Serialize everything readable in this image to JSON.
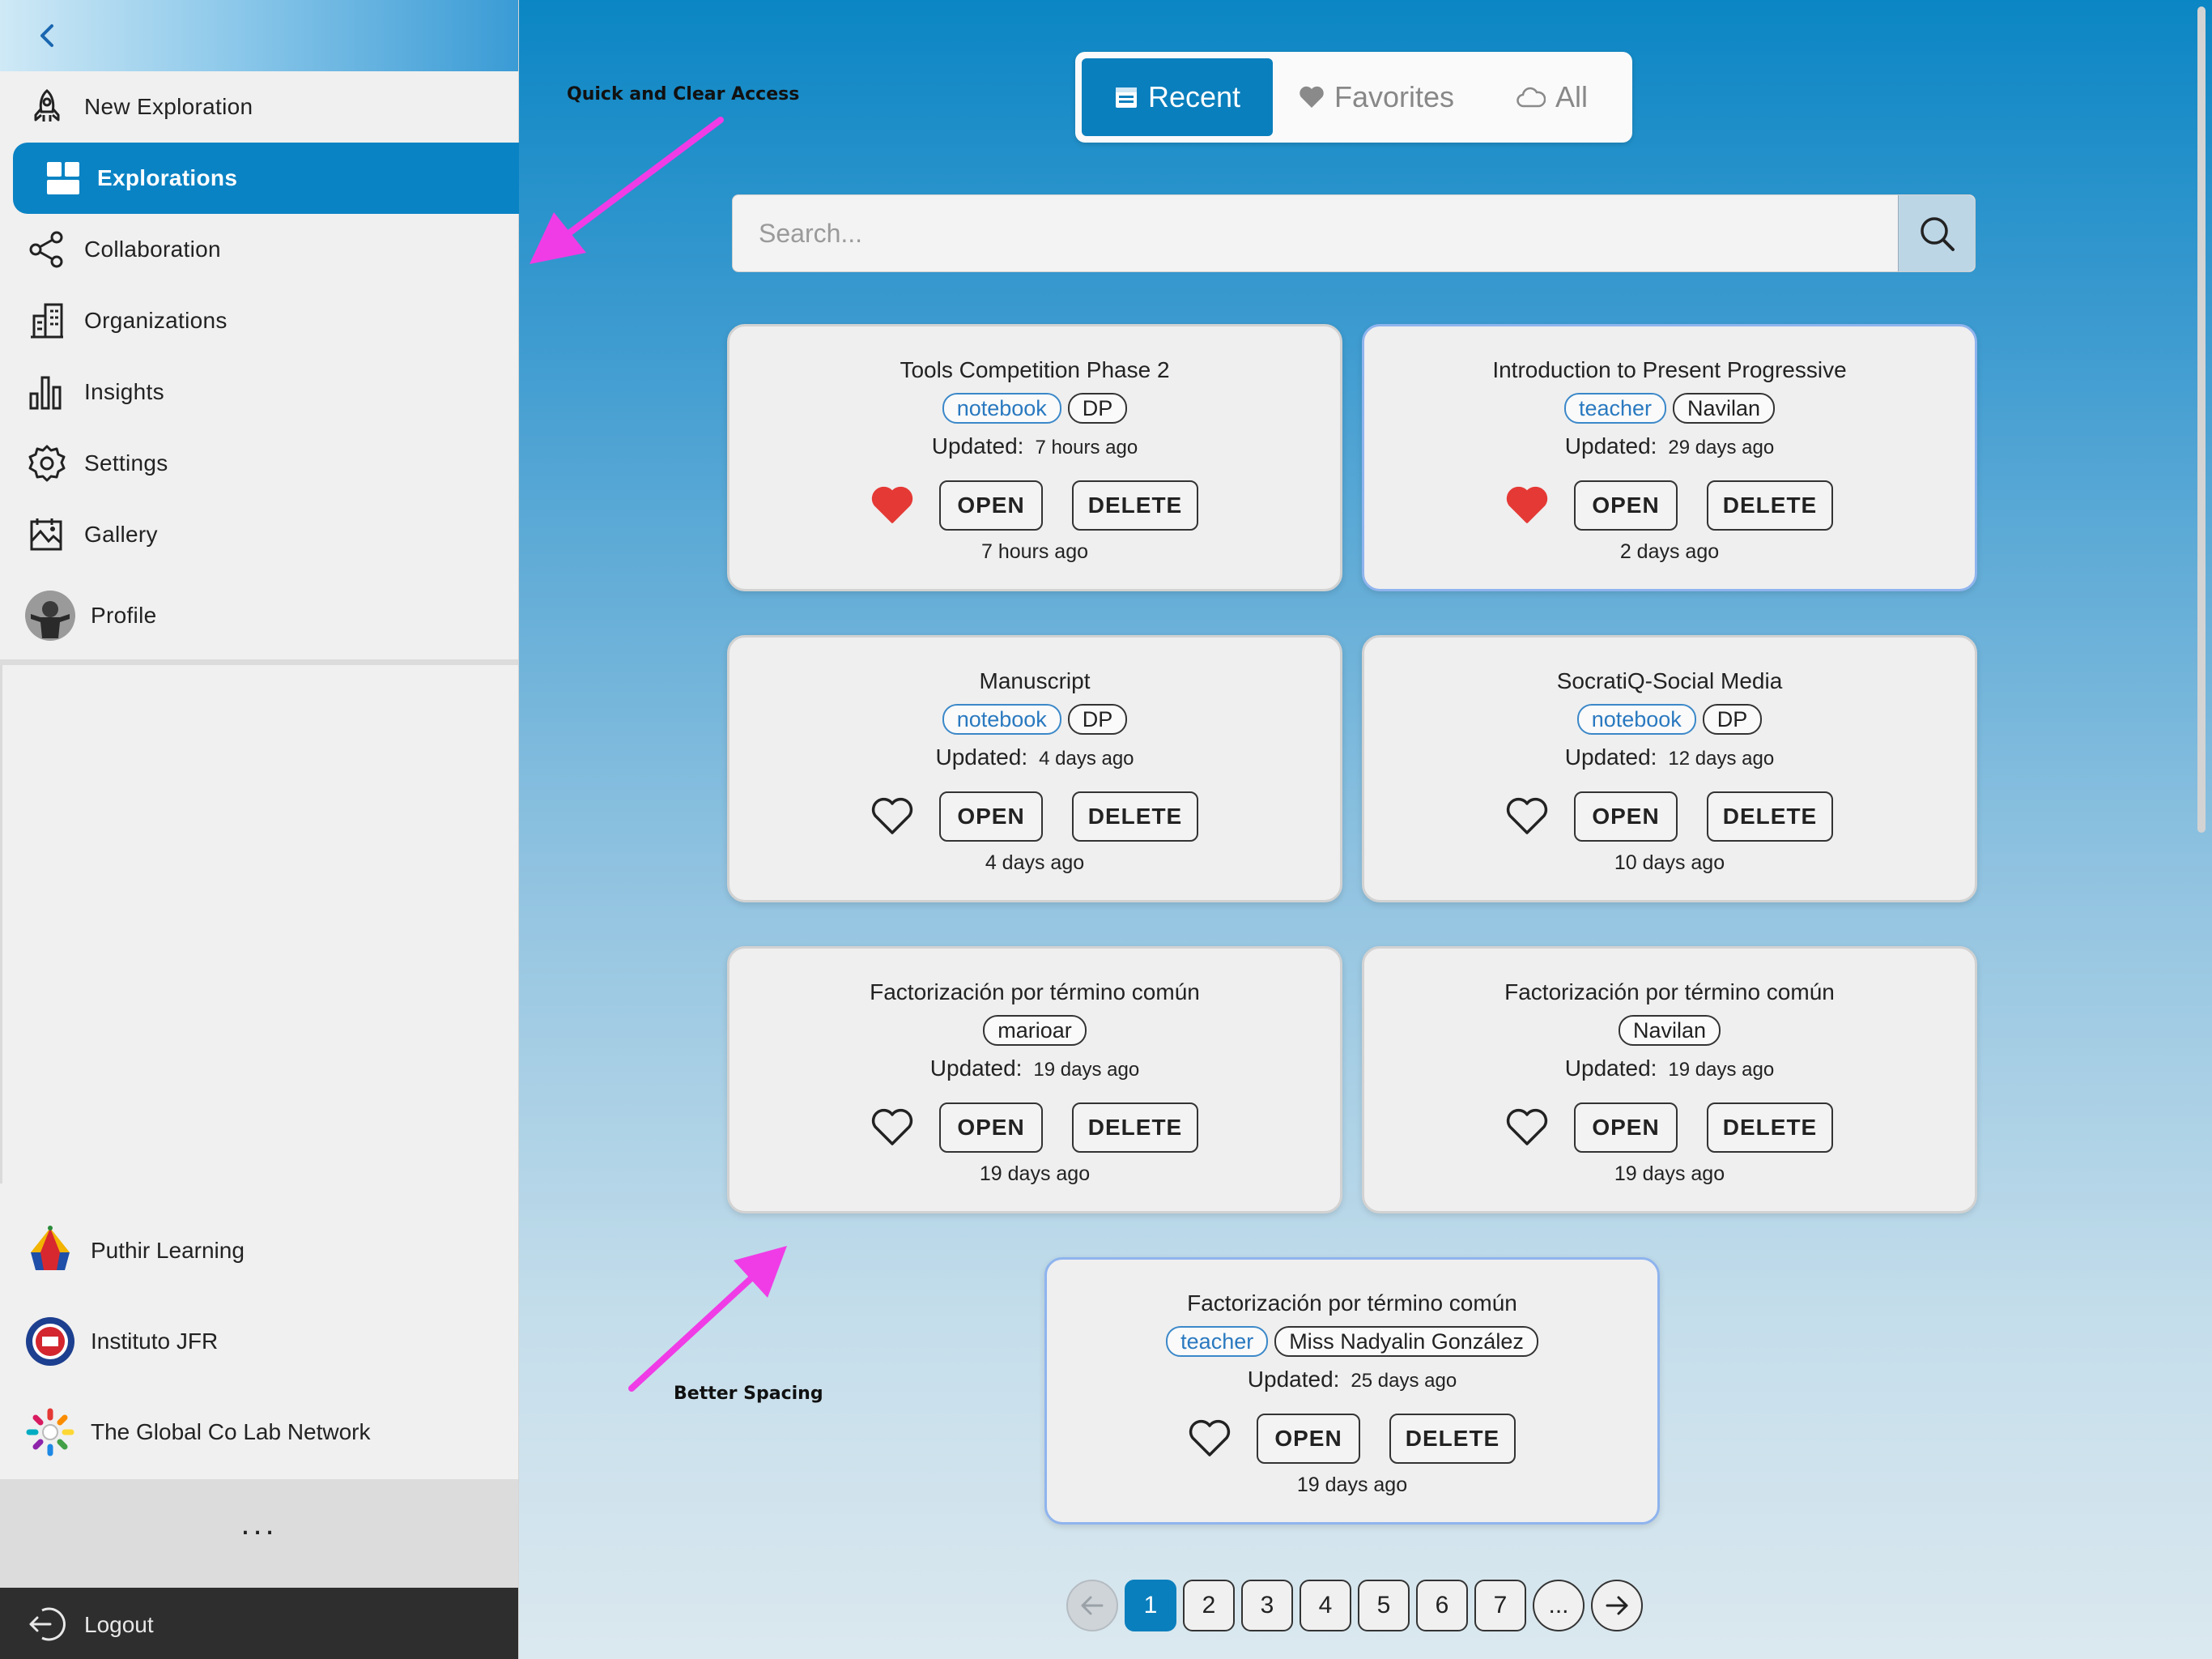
{
  "sidebar": {
    "nav": [
      {
        "label": "New Exploration",
        "icon": "rocket-icon"
      },
      {
        "label": "Explorations",
        "icon": "grid-icon",
        "active": true
      },
      {
        "label": "Collaboration",
        "icon": "share-icon"
      },
      {
        "label": "Organizations",
        "icon": "building-icon"
      },
      {
        "label": "Insights",
        "icon": "bar-chart-icon"
      },
      {
        "label": "Settings",
        "icon": "gear-icon"
      },
      {
        "label": "Gallery",
        "icon": "gallery-icon"
      },
      {
        "label": "Profile",
        "icon": "avatar"
      }
    ],
    "orgs": [
      {
        "label": "Puthir Learning"
      },
      {
        "label": "Instituto JFR"
      },
      {
        "label": "The Global Co Lab Network"
      }
    ],
    "more_label": "...",
    "logout_label": "Logout"
  },
  "tabs": [
    {
      "label": "Recent",
      "icon": "calendar-icon",
      "active": true
    },
    {
      "label": "Favorites",
      "icon": "heart-icon"
    },
    {
      "label": "All",
      "icon": "cloud-icon"
    }
  ],
  "search": {
    "placeholder": "Search...",
    "value": ""
  },
  "updated_label": "Updated:",
  "open_label": "OPEN",
  "delete_label": "DELETE",
  "cards": [
    {
      "title": "Tools Competition Phase 2",
      "tags": [
        {
          "text": "notebook",
          "style": "blue"
        },
        {
          "text": "DP"
        }
      ],
      "updated": "7 hours ago",
      "favorite": true,
      "sub": "7 hours ago"
    },
    {
      "title": "Introduction to Present Progressive",
      "tags": [
        {
          "text": "teacher",
          "style": "blue"
        },
        {
          "text": "Navilan"
        }
      ],
      "updated": "29 days ago",
      "favorite": true,
      "sub": "2 days ago",
      "highlight": true
    },
    {
      "title": "Manuscript",
      "tags": [
        {
          "text": "notebook",
          "style": "blue"
        },
        {
          "text": "DP"
        }
      ],
      "updated": "4 days ago",
      "favorite": false,
      "sub": "4 days ago"
    },
    {
      "title": "SocratiQ-Social Media",
      "tags": [
        {
          "text": "notebook",
          "style": "blue"
        },
        {
          "text": "DP"
        }
      ],
      "updated": "12 days ago",
      "favorite": false,
      "sub": "10 days ago"
    },
    {
      "title": "Factorización por término común",
      "tags": [
        {
          "text": "marioar"
        }
      ],
      "updated": "19 days ago",
      "favorite": false,
      "sub": "19 days ago"
    },
    {
      "title": "Factorización por término común",
      "tags": [
        {
          "text": "Navilan"
        }
      ],
      "updated": "19 days ago",
      "favorite": false,
      "sub": "19 days ago"
    },
    {
      "title": "Factorización por término común",
      "tags": [
        {
          "text": "teacher",
          "style": "blue"
        },
        {
          "text": "Miss Nadyalin González"
        }
      ],
      "updated": "25 days ago",
      "favorite": false,
      "sub": "19 days ago",
      "highlight": true
    }
  ],
  "pagination": {
    "pages": [
      "1",
      "2",
      "3",
      "4",
      "5",
      "6",
      "7",
      "..."
    ],
    "current": "1"
  },
  "annotations": {
    "top": "Quick and Clear Access",
    "bottom": "Better Spacing"
  },
  "colors": {
    "accent": "#0a7fbd",
    "heart": "#e53935",
    "annotation_arrow": "#f03ce6"
  }
}
